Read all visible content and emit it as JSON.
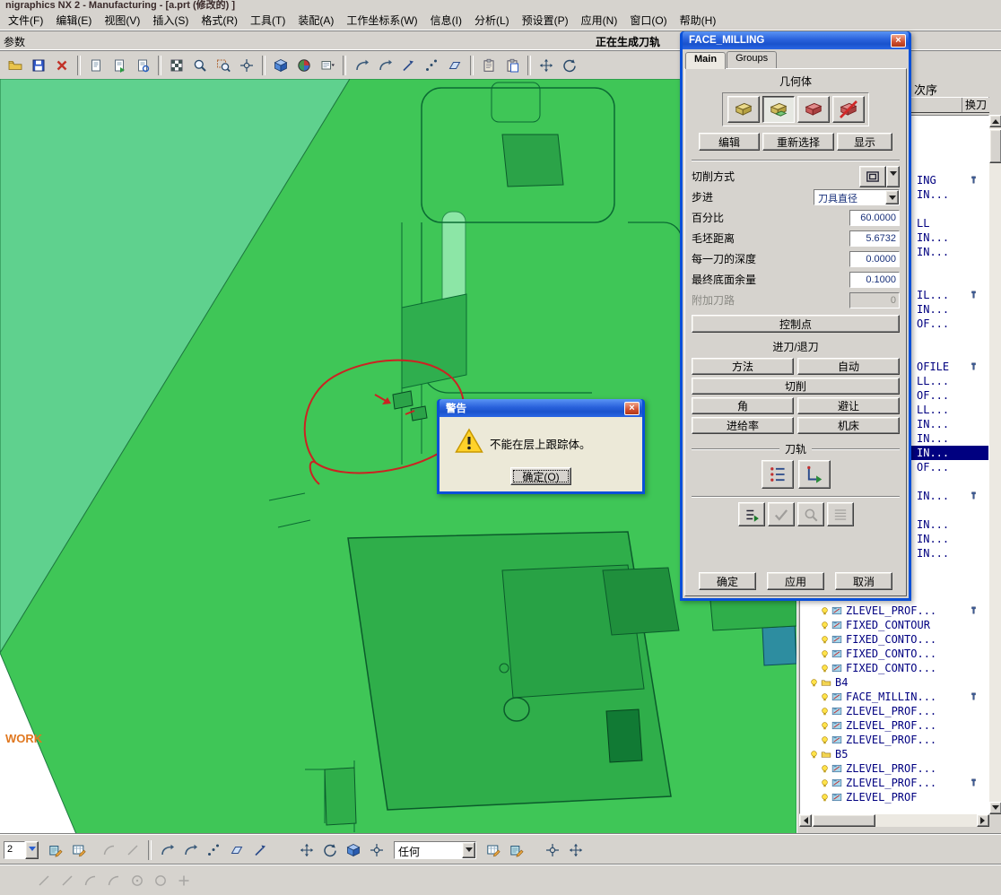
{
  "window": {
    "title": "nigraphics NX 2 - Manufacturing - [a.prt (修改的) ]"
  },
  "menu": {
    "items": [
      "文件(F)",
      "编辑(E)",
      "视图(V)",
      "插入(S)",
      "格式(R)",
      "工具(T)",
      "装配(A)",
      "工作坐标系(W)",
      "信息(I)",
      "分析(L)",
      "预设置(P)",
      "应用(N)",
      "窗口(O)",
      "帮助(H)"
    ]
  },
  "params_bar": {
    "label": "参数",
    "status": "正在生成刀轨"
  },
  "main_toolbar": {
    "icons": [
      {
        "name": "open",
        "kind": "folder"
      },
      {
        "name": "save",
        "kind": "floppy"
      },
      {
        "name": "delete",
        "kind": "xmark"
      },
      {
        "sep": true
      },
      {
        "name": "view-refresh",
        "kind": "sheet"
      },
      {
        "name": "view-update",
        "kind": "sheetA"
      },
      {
        "name": "view-regenerate",
        "kind": "sheetB"
      },
      {
        "sep": true
      },
      {
        "name": "display-mode",
        "kind": "flag"
      },
      {
        "name": "zoom",
        "kind": "zoom"
      },
      {
        "name": "zoom-window",
        "kind": "zoombox"
      },
      {
        "name": "pan",
        "kind": "crosshair"
      },
      {
        "sep": true
      },
      {
        "name": "shaded-view",
        "kind": "cube"
      },
      {
        "name": "render-style",
        "kind": "sphere"
      },
      {
        "name": "view-layout",
        "kind": "boxdrop"
      },
      {
        "sep": true
      },
      {
        "name": "curve-rule",
        "kind": "arrowj"
      },
      {
        "name": "edge-rule",
        "kind": "arrowj"
      },
      {
        "name": "vector-tool",
        "kind": "vector"
      },
      {
        "name": "point-tool",
        "kind": "point3"
      },
      {
        "name": "plane-tool",
        "kind": "plane"
      },
      {
        "sep": true
      },
      {
        "name": "copy",
        "kind": "clip"
      },
      {
        "name": "paste",
        "kind": "clip2"
      },
      {
        "sep": true
      },
      {
        "name": "orient-view",
        "kind": "move"
      },
      {
        "name": "rotate-view",
        "kind": "rotate"
      }
    ]
  },
  "viewport": {
    "wcs_label": "WORK"
  },
  "navigator": {
    "title_fragment": "次序",
    "columns": {
      "tool_change": "换刀"
    },
    "rows": [
      {
        "kind": "empty"
      },
      {
        "kind": "empty"
      },
      {
        "kind": "empty"
      },
      {
        "kind": "empty"
      },
      {
        "kind": "fragment",
        "text": "ING",
        "tool_change": true
      },
      {
        "kind": "fragment",
        "text": "IN..."
      },
      {
        "kind": "empty"
      },
      {
        "kind": "fragment",
        "text": "LL"
      },
      {
        "kind": "fragment",
        "text": "IN..."
      },
      {
        "kind": "fragment",
        "text": "IN..."
      },
      {
        "kind": "empty"
      },
      {
        "kind": "empty"
      },
      {
        "kind": "fragment",
        "text": "IL...",
        "tool_change": true
      },
      {
        "kind": "fragment",
        "text": "IN..."
      },
      {
        "kind": "fragment",
        "text": "OF..."
      },
      {
        "kind": "empty"
      },
      {
        "kind": "empty"
      },
      {
        "kind": "fragment",
        "text": "OFILE",
        "tool_change": true
      },
      {
        "kind": "fragment",
        "text": "LL..."
      },
      {
        "kind": "fragment",
        "text": "OF..."
      },
      {
        "kind": "fragment",
        "text": "LL..."
      },
      {
        "kind": "fragment",
        "text": "IN..."
      },
      {
        "kind": "fragment",
        "text": "IN..."
      },
      {
        "kind": "fragment",
        "text": "IN...",
        "selected": true
      },
      {
        "kind": "fragment",
        "text": "OF..."
      },
      {
        "kind": "empty"
      },
      {
        "kind": "fragment",
        "text": "IN...",
        "tool_change": true
      },
      {
        "kind": "empty"
      },
      {
        "kind": "fragment",
        "text": "IN..."
      },
      {
        "kind": "fragment",
        "text": "IN..."
      },
      {
        "kind": "fragment",
        "text": "IN..."
      },
      {
        "kind": "empty"
      },
      {
        "kind": "empty"
      },
      {
        "kind": "empty"
      },
      {
        "kind": "op",
        "text": "ZLEVEL_PROF...",
        "tool_change": true
      },
      {
        "kind": "op",
        "text": "FIXED_CONTOUR"
      },
      {
        "kind": "op",
        "text": "FIXED_CONTO..."
      },
      {
        "kind": "op",
        "text": "FIXED_CONTO..."
      },
      {
        "kind": "op",
        "text": "FIXED_CONTO..."
      },
      {
        "kind": "group",
        "text": "B4"
      },
      {
        "kind": "op",
        "text": "FACE_MILLIN...",
        "tool_change": true
      },
      {
        "kind": "op",
        "text": "ZLEVEL_PROF..."
      },
      {
        "kind": "op",
        "text": "ZLEVEL_PROF..."
      },
      {
        "kind": "op",
        "text": "ZLEVEL_PROF..."
      },
      {
        "kind": "group",
        "text": "B5"
      },
      {
        "kind": "op",
        "text": "ZLEVEL_PROF..."
      },
      {
        "kind": "op",
        "text": "ZLEVEL_PROF...",
        "tool_change": true
      },
      {
        "kind": "op",
        "text": "ZLEVEL_PROF"
      }
    ]
  },
  "face_dialog": {
    "title": "FACE_MILLING",
    "tabs": [
      {
        "label": "Main",
        "active": true
      },
      {
        "label": "Groups",
        "active": false
      }
    ],
    "geometry": {
      "label": "几何体",
      "icons": [
        {
          "name": "geometry-part",
          "kind": "geoY"
        },
        {
          "name": "geometry-blank",
          "kind": "geoY2",
          "pressed": true
        },
        {
          "name": "geometry-check",
          "kind": "geoR"
        },
        {
          "name": "geometry-trim",
          "kind": "geoRX"
        }
      ],
      "buttons": [
        "编辑",
        "重新选择",
        "显示"
      ]
    },
    "params": [
      {
        "label": "切削方式",
        "type": "icon_combo"
      },
      {
        "label": "步进",
        "type": "combo",
        "value": "刀具直径"
      },
      {
        "label": "百分比",
        "type": "number",
        "value": "60.0000"
      },
      {
        "label": "毛坯距离",
        "type": "number",
        "value": "5.6732"
      },
      {
        "label": "每一刀的深度",
        "type": "number",
        "value": "0.0000"
      },
      {
        "label": "最终底面余量",
        "type": "number",
        "value": "0.1000"
      },
      {
        "label": "附加刀路",
        "type": "number",
        "value": "0",
        "disabled": true
      }
    ],
    "control_point_label": "控制点",
    "engage_retract_label": "进刀/退刀",
    "action_buttons": [
      "方法",
      "自动",
      "切削",
      "角",
      "避让",
      "进给率",
      "机床"
    ],
    "toolpath": {
      "label": "刀轨",
      "icons": [
        {
          "name": "toolpath-generate",
          "kind": "tp1"
        },
        {
          "name": "toolpath-edit",
          "kind": "tp2"
        }
      ],
      "verify_icons": [
        {
          "name": "toolpath-replay",
          "kind": "v1"
        },
        {
          "name": "toolpath-verify",
          "kind": "v2",
          "disabled": true
        },
        {
          "name": "toolpath-gouge-check",
          "kind": "v3",
          "disabled": true
        },
        {
          "name": "toolpath-list",
          "kind": "v4",
          "disabled": true
        }
      ]
    },
    "footer_buttons": [
      "确定",
      "应用",
      "取消"
    ]
  },
  "warning_dialog": {
    "title": "警告",
    "message": "不能在层上跟踪体。",
    "ok_label": "确定(O)"
  },
  "bottom_toolbar": {
    "zoom_value": "2",
    "filter_value": "任何",
    "row1a": [
      {
        "name": "tool-edit",
        "kind": "book"
      },
      {
        "name": "operation-edit",
        "kind": "tablep"
      },
      {
        "gap": 8
      },
      {
        "name": "curve-tool-1",
        "kind": "arc",
        "disabled": true
      },
      {
        "name": "curve-tool-2",
        "kind": "line",
        "disabled": true
      },
      {
        "sep": true
      },
      {
        "name": "snap-end",
        "kind": "arrowj"
      },
      {
        "name": "snap-tangent",
        "kind": "arrowj"
      },
      {
        "name": "point-constructor",
        "kind": "point3"
      },
      {
        "name": "datum-plane",
        "kind": "plane"
      },
      {
        "name": "vector-constructor",
        "kind": "vector"
      },
      {
        "gap": 26
      },
      {
        "name": "dynamic-wcs",
        "kind": "move"
      },
      {
        "name": "rotate-wcs",
        "kind": "rotate"
      },
      {
        "name": "wcs-orient",
        "kind": "cube"
      },
      {
        "name": "snap-point",
        "kind": "crosshair"
      }
    ],
    "row1b": [
      {
        "name": "grid-edit",
        "kind": "tablep"
      },
      {
        "name": "list-edit",
        "kind": "book"
      },
      {
        "gap": 14
      },
      {
        "name": "target-position",
        "kind": "crosshair"
      },
      {
        "name": "reference-position",
        "kind": "move"
      }
    ],
    "row2": [
      {
        "name": "line",
        "kind": "line",
        "disabled": true
      },
      {
        "name": "line-2",
        "kind": "line",
        "disabled": true
      },
      {
        "name": "arc",
        "kind": "arc",
        "disabled": true
      },
      {
        "name": "arc-2",
        "kind": "arc",
        "disabled": true
      },
      {
        "name": "circle-center",
        "kind": "circdot",
        "disabled": true
      },
      {
        "name": "circle",
        "kind": "circ",
        "disabled": true
      },
      {
        "name": "point",
        "kind": "plus",
        "disabled": true
      }
    ]
  }
}
